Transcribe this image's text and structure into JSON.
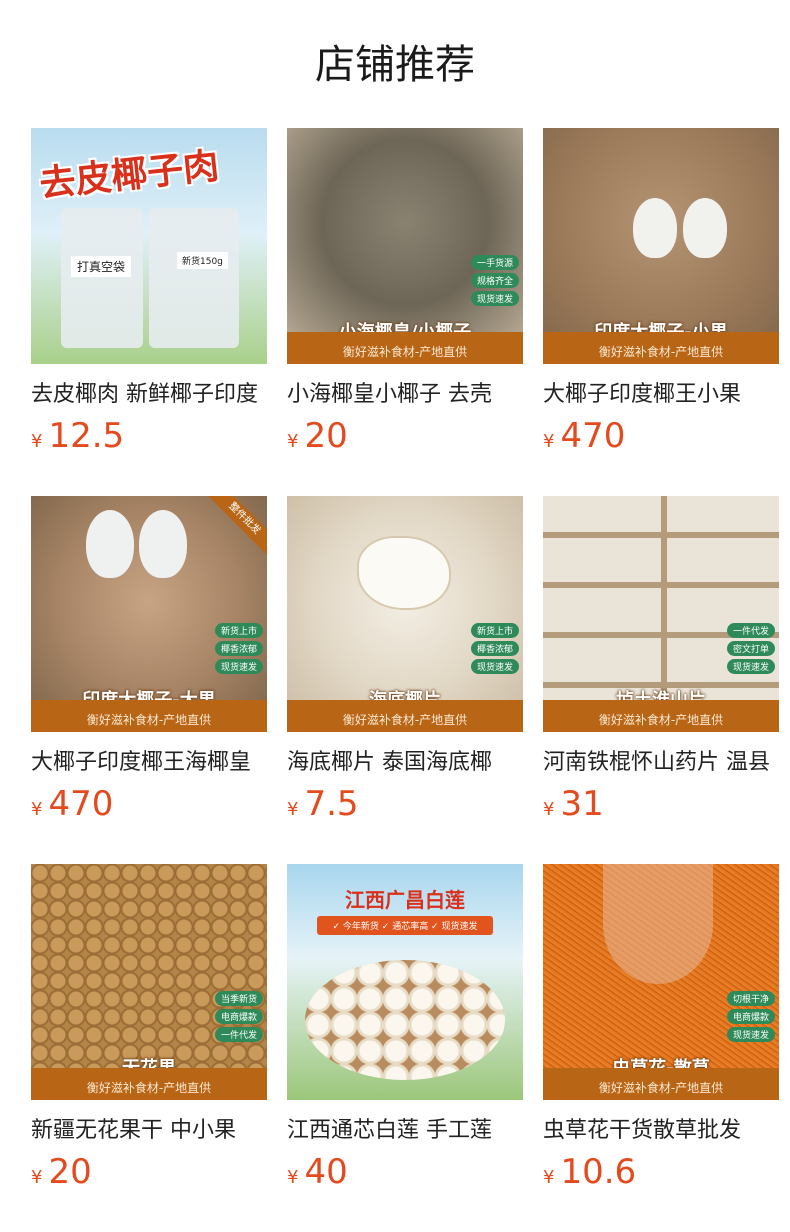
{
  "page_title": "店铺推荐",
  "currency_symbol": "¥",
  "band_subtitle": "衡好滋补食材-产地直供",
  "colors": {
    "price": "#e34a1e",
    "band": "#b86516",
    "badge": "#2f8a5a"
  },
  "products": [
    {
      "name": "去皮椰肉 新鲜椰子印度",
      "price": "12.5",
      "image": {
        "poster_title": "去皮椰子肉",
        "tag": "打真空袋",
        "weight": "新货150g"
      }
    },
    {
      "name": "小海椰皇小椰子 去壳",
      "price": "20",
      "image": {
        "band_title": "小海椰皇/小椰子",
        "badges": [
          "一手货源",
          "规格齐全",
          "现货速发"
        ]
      }
    },
    {
      "name": "大椰子印度椰王小果",
      "price": "470",
      "image": {
        "band_title": "印度大椰子-小果"
      }
    },
    {
      "name": "大椰子印度椰王海椰皇",
      "price": "470",
      "image": {
        "band_title": "印度大椰子-大果",
        "corner": "整件批发",
        "badges": [
          "新货上市",
          "椰香浓郁",
          "现货速发"
        ]
      }
    },
    {
      "name": "海底椰片 泰国海底椰",
      "price": "7.5",
      "image": {
        "band_title": "海底椰片",
        "badges": [
          "新货上市",
          "椰香浓郁",
          "现货速发"
        ]
      }
    },
    {
      "name": "河南铁棍怀山药片 温县",
      "price": "31",
      "image": {
        "band_title": "垆土淮山片",
        "badges": [
          "一件代发",
          "密文打单",
          "现货速发"
        ]
      }
    },
    {
      "name": "新疆无花果干 中小果",
      "price": "20",
      "image": {
        "band_title": "无花果",
        "badges": [
          "当季新货",
          "电商爆款",
          "一件代发"
        ]
      }
    },
    {
      "name": "江西通芯白莲 手工莲",
      "price": "40",
      "image": {
        "poster_title": "江西广昌白莲",
        "top_sub": "✓ 今年新货  ✓ 通芯率高  ✓ 现货速发"
      }
    },
    {
      "name": "虫草花干货散草批发",
      "price": "10.6",
      "image": {
        "band_title": "虫草花-散草",
        "badges": [
          "切根干净",
          "电商爆款",
          "现货速发"
        ]
      }
    }
  ]
}
